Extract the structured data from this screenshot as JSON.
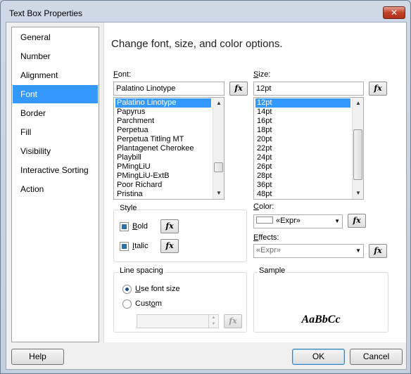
{
  "window": {
    "title": "Text Box Properties",
    "close_glyph": "✕"
  },
  "sidebar": {
    "items": [
      {
        "label": "General"
      },
      {
        "label": "Number"
      },
      {
        "label": "Alignment"
      },
      {
        "label": "Font"
      },
      {
        "label": "Border"
      },
      {
        "label": "Fill"
      },
      {
        "label": "Visibility"
      },
      {
        "label": "Interactive Sorting"
      },
      {
        "label": "Action"
      }
    ],
    "selected": "Font"
  },
  "content": {
    "heading": "Change font, size, and color options.",
    "font": {
      "label_accel": "F",
      "label_rest": "ont:",
      "value": "Palatino Linotype",
      "fx": "fx",
      "options": [
        "Palatino Linotype",
        "Papyrus",
        "Parchment",
        "Perpetua",
        "Perpetua Titling MT",
        "Plantagenet Cherokee",
        "Playbill",
        "PMingLiU",
        "PMingLiU-ExtB",
        "Poor Richard",
        "Pristina"
      ],
      "selected_index": 0
    },
    "size": {
      "label_accel": "S",
      "label_rest": "ize:",
      "value": "12pt",
      "fx": "fx",
      "options": [
        "12pt",
        "14pt",
        "16pt",
        "18pt",
        "20pt",
        "22pt",
        "24pt",
        "26pt",
        "28pt",
        "36pt",
        "48pt"
      ],
      "selected_index": 0
    },
    "style": {
      "title": "Style",
      "bold": {
        "accel": "B",
        "rest": "old",
        "checked": true,
        "fx": "fx"
      },
      "italic": {
        "accel": "I",
        "rest": "talic",
        "checked": true,
        "fx": "fx"
      }
    },
    "color": {
      "label_accel": "C",
      "label_rest": "olor:",
      "value": "«Expr»",
      "fx": "fx"
    },
    "effects": {
      "label_accel": "E",
      "label_rest": "ffects:",
      "value": "«Expr»",
      "fx": "fx"
    },
    "line_spacing": {
      "title": "Line spacing",
      "use_font_size": {
        "accel": "U",
        "rest": "se font size",
        "selected": true
      },
      "custom": {
        "pre": "Cust",
        "accel": "o",
        "rest": "m",
        "selected": false
      },
      "custom_value": "",
      "fx": "fx"
    },
    "sample": {
      "title": "Sample",
      "text": "AaBbCc"
    }
  },
  "footer": {
    "help": "Help",
    "ok": "OK",
    "cancel": "Cancel"
  }
}
